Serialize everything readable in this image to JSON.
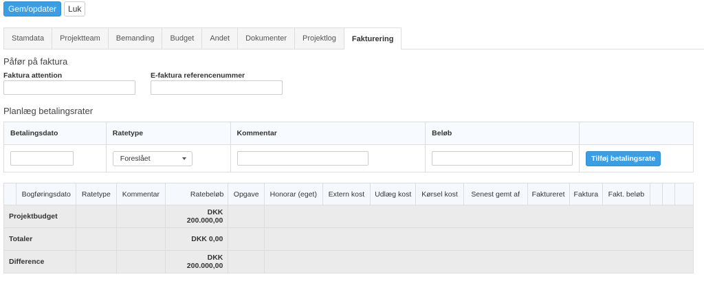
{
  "toolbar": {
    "save_label": "Gem/opdater",
    "close_label": "Luk"
  },
  "tabs": [
    {
      "label": "Stamdata",
      "active": false
    },
    {
      "label": "Projektteam",
      "active": false
    },
    {
      "label": "Bemanding",
      "active": false
    },
    {
      "label": "Budget",
      "active": false
    },
    {
      "label": "Andet",
      "active": false
    },
    {
      "label": "Dokumenter",
      "active": false
    },
    {
      "label": "Projektlog",
      "active": false
    },
    {
      "label": "Fakturering",
      "active": true
    }
  ],
  "invoice_section": {
    "title": "Påfør på faktura",
    "attention_label": "Faktura attention",
    "attention_value": "",
    "ref_label": "E-faktura referencenummer",
    "ref_value": ""
  },
  "rates_section": {
    "title": "Planlæg betalingsrater",
    "headers": [
      "Betalingsdato",
      "Ratetype",
      "Kommentar",
      "Beløb",
      ""
    ],
    "ratetype_selected": "Foreslået",
    "add_button": "Tilføj betalingsrate"
  },
  "grid": {
    "headers": [
      "",
      "Bogføringsdato",
      "Ratetype",
      "Kommentar",
      "Ratebeløb",
      "Opgave",
      "Honorar (eget)",
      "Extern kost",
      "Udlæg kost",
      "Kørsel kost",
      "Senest gemt af",
      "Faktureret",
      "Faktura",
      "Fakt. beløb",
      "",
      "",
      ""
    ],
    "rows": [
      {
        "label": "Projektbudget",
        "amount": "DKK 200.000,00"
      },
      {
        "label": "Totaler",
        "amount": "DKK 0,00"
      },
      {
        "label": "Difference",
        "amount": "DKK 200.000,00"
      }
    ]
  },
  "colors": {
    "primary": "#3b9ee3",
    "tab_bg": "#f5f5f5",
    "summary_bg": "#ebebeb"
  }
}
